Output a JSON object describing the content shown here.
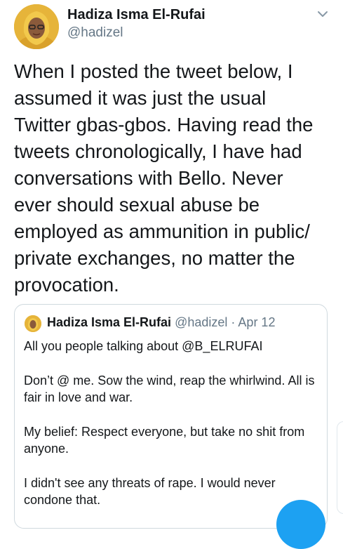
{
  "author": {
    "display_name": "Hadiza Isma El-Rufai",
    "handle": "@hadizel"
  },
  "tweet": {
    "text": "When I posted the tweet below, I\nassumed it was just the usual\nTwitter gbas-gbos. Having read the\ntweets chronologically, I have had\nconversations with Bello. Never\never should sexual abuse be\nemployed as ammunition in public/\nprivate exchanges, no matter the\nprovocation."
  },
  "quoted_tweet": {
    "display_name": "Hadiza Isma El-Rufai",
    "handle": "@hadizel",
    "separator": "·",
    "date": "Apr 12",
    "paragraphs": [
      "All you people talking about @B_ELRUFAI",
      "Don’t @ me. Sow the wind, reap the whirlwind. All is fair in love and war.",
      "My belief: Respect everyone, but take no shit from anyone.",
      "I didn't see any threats of rape. I would never condone that."
    ]
  },
  "icons": {
    "menu": "chevron-down-icon",
    "compose": "compose-fab"
  },
  "colors": {
    "text": "#14171a",
    "secondary": "#657786",
    "border": "#cfd9de",
    "accent": "#1da1f2"
  }
}
